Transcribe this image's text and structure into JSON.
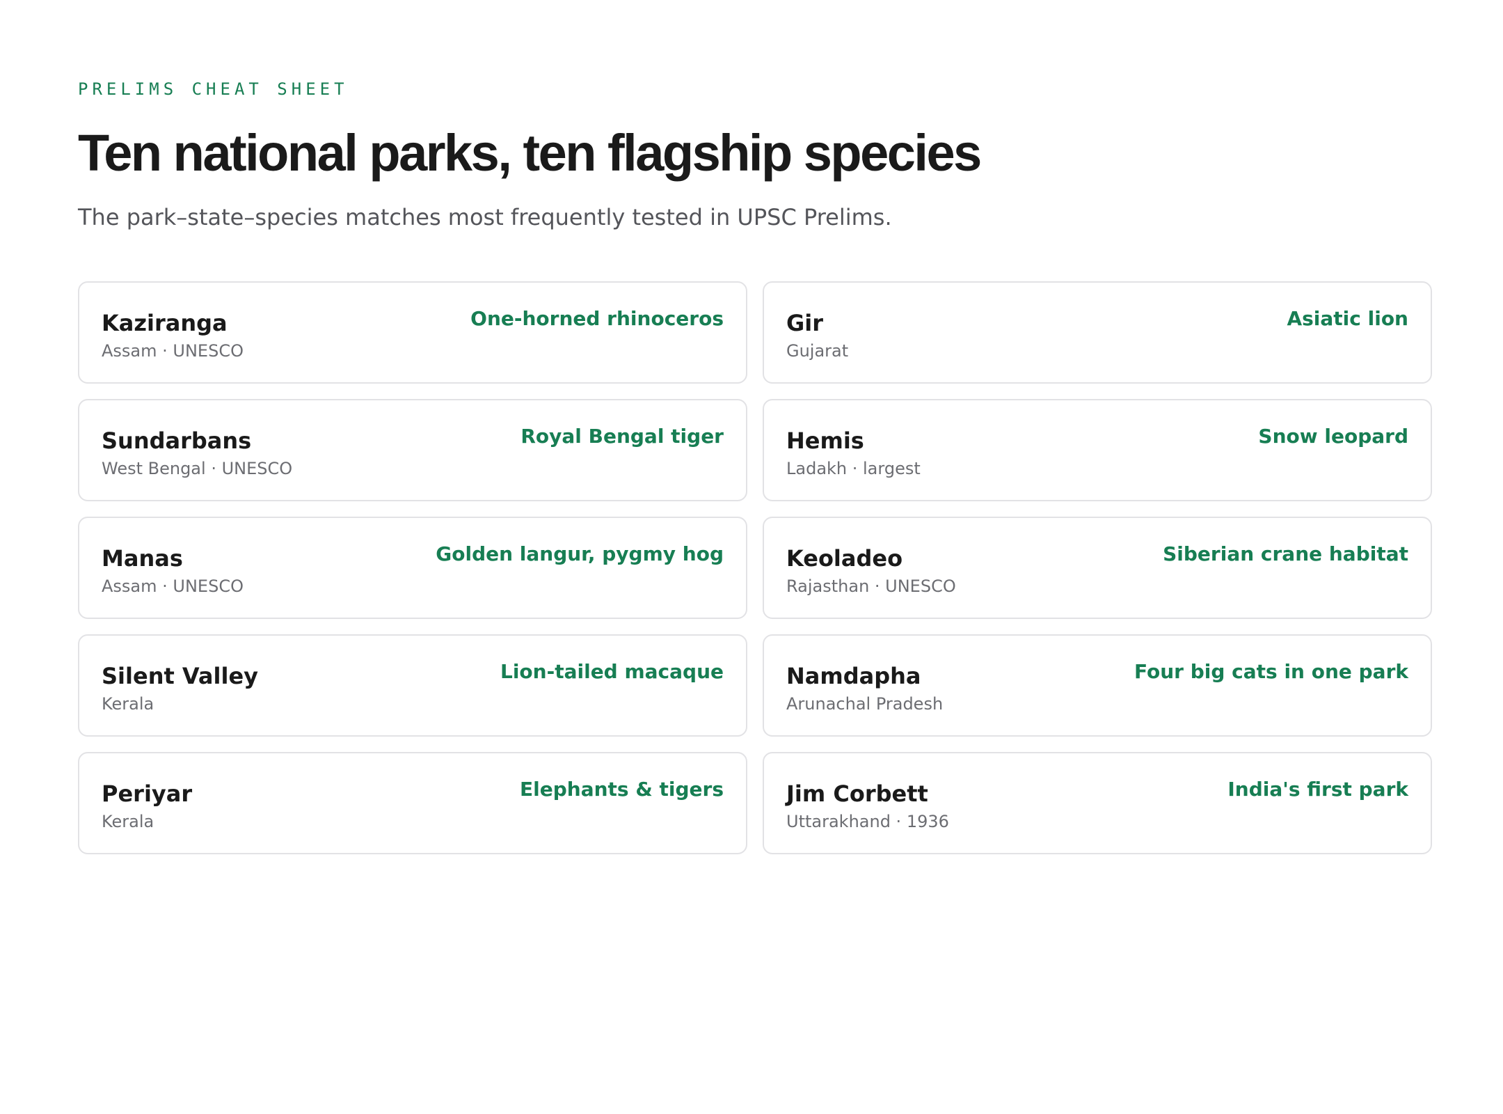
{
  "header": {
    "eyebrow": "PRELIMS CHEAT SHEET",
    "title": "Ten national parks, ten flagship species",
    "subtitle": "The park–state–species matches most frequently tested in UPSC Prelims."
  },
  "accent_color": "#177e53",
  "parks": [
    {
      "name": "Kaziranga",
      "meta": "Assam · UNESCO",
      "species": "One-horned rhinoceros"
    },
    {
      "name": "Gir",
      "meta": "Gujarat",
      "species": "Asiatic lion"
    },
    {
      "name": "Sundarbans",
      "meta": "West Bengal · UNESCO",
      "species": "Royal Bengal tiger"
    },
    {
      "name": "Hemis",
      "meta": "Ladakh · largest",
      "species": "Snow leopard"
    },
    {
      "name": "Manas",
      "meta": "Assam · UNESCO",
      "species": "Golden langur, pygmy hog"
    },
    {
      "name": "Keoladeo",
      "meta": "Rajasthan · UNESCO",
      "species": "Siberian crane habitat"
    },
    {
      "name": "Silent Valley",
      "meta": "Kerala",
      "species": "Lion-tailed macaque"
    },
    {
      "name": "Namdapha",
      "meta": "Arunachal Pradesh",
      "species": "Four big cats in one park"
    },
    {
      "name": "Periyar",
      "meta": "Kerala",
      "species": "Elephants & tigers"
    },
    {
      "name": "Jim Corbett",
      "meta": "Uttarakhand · 1936",
      "species": "India's first park"
    }
  ]
}
